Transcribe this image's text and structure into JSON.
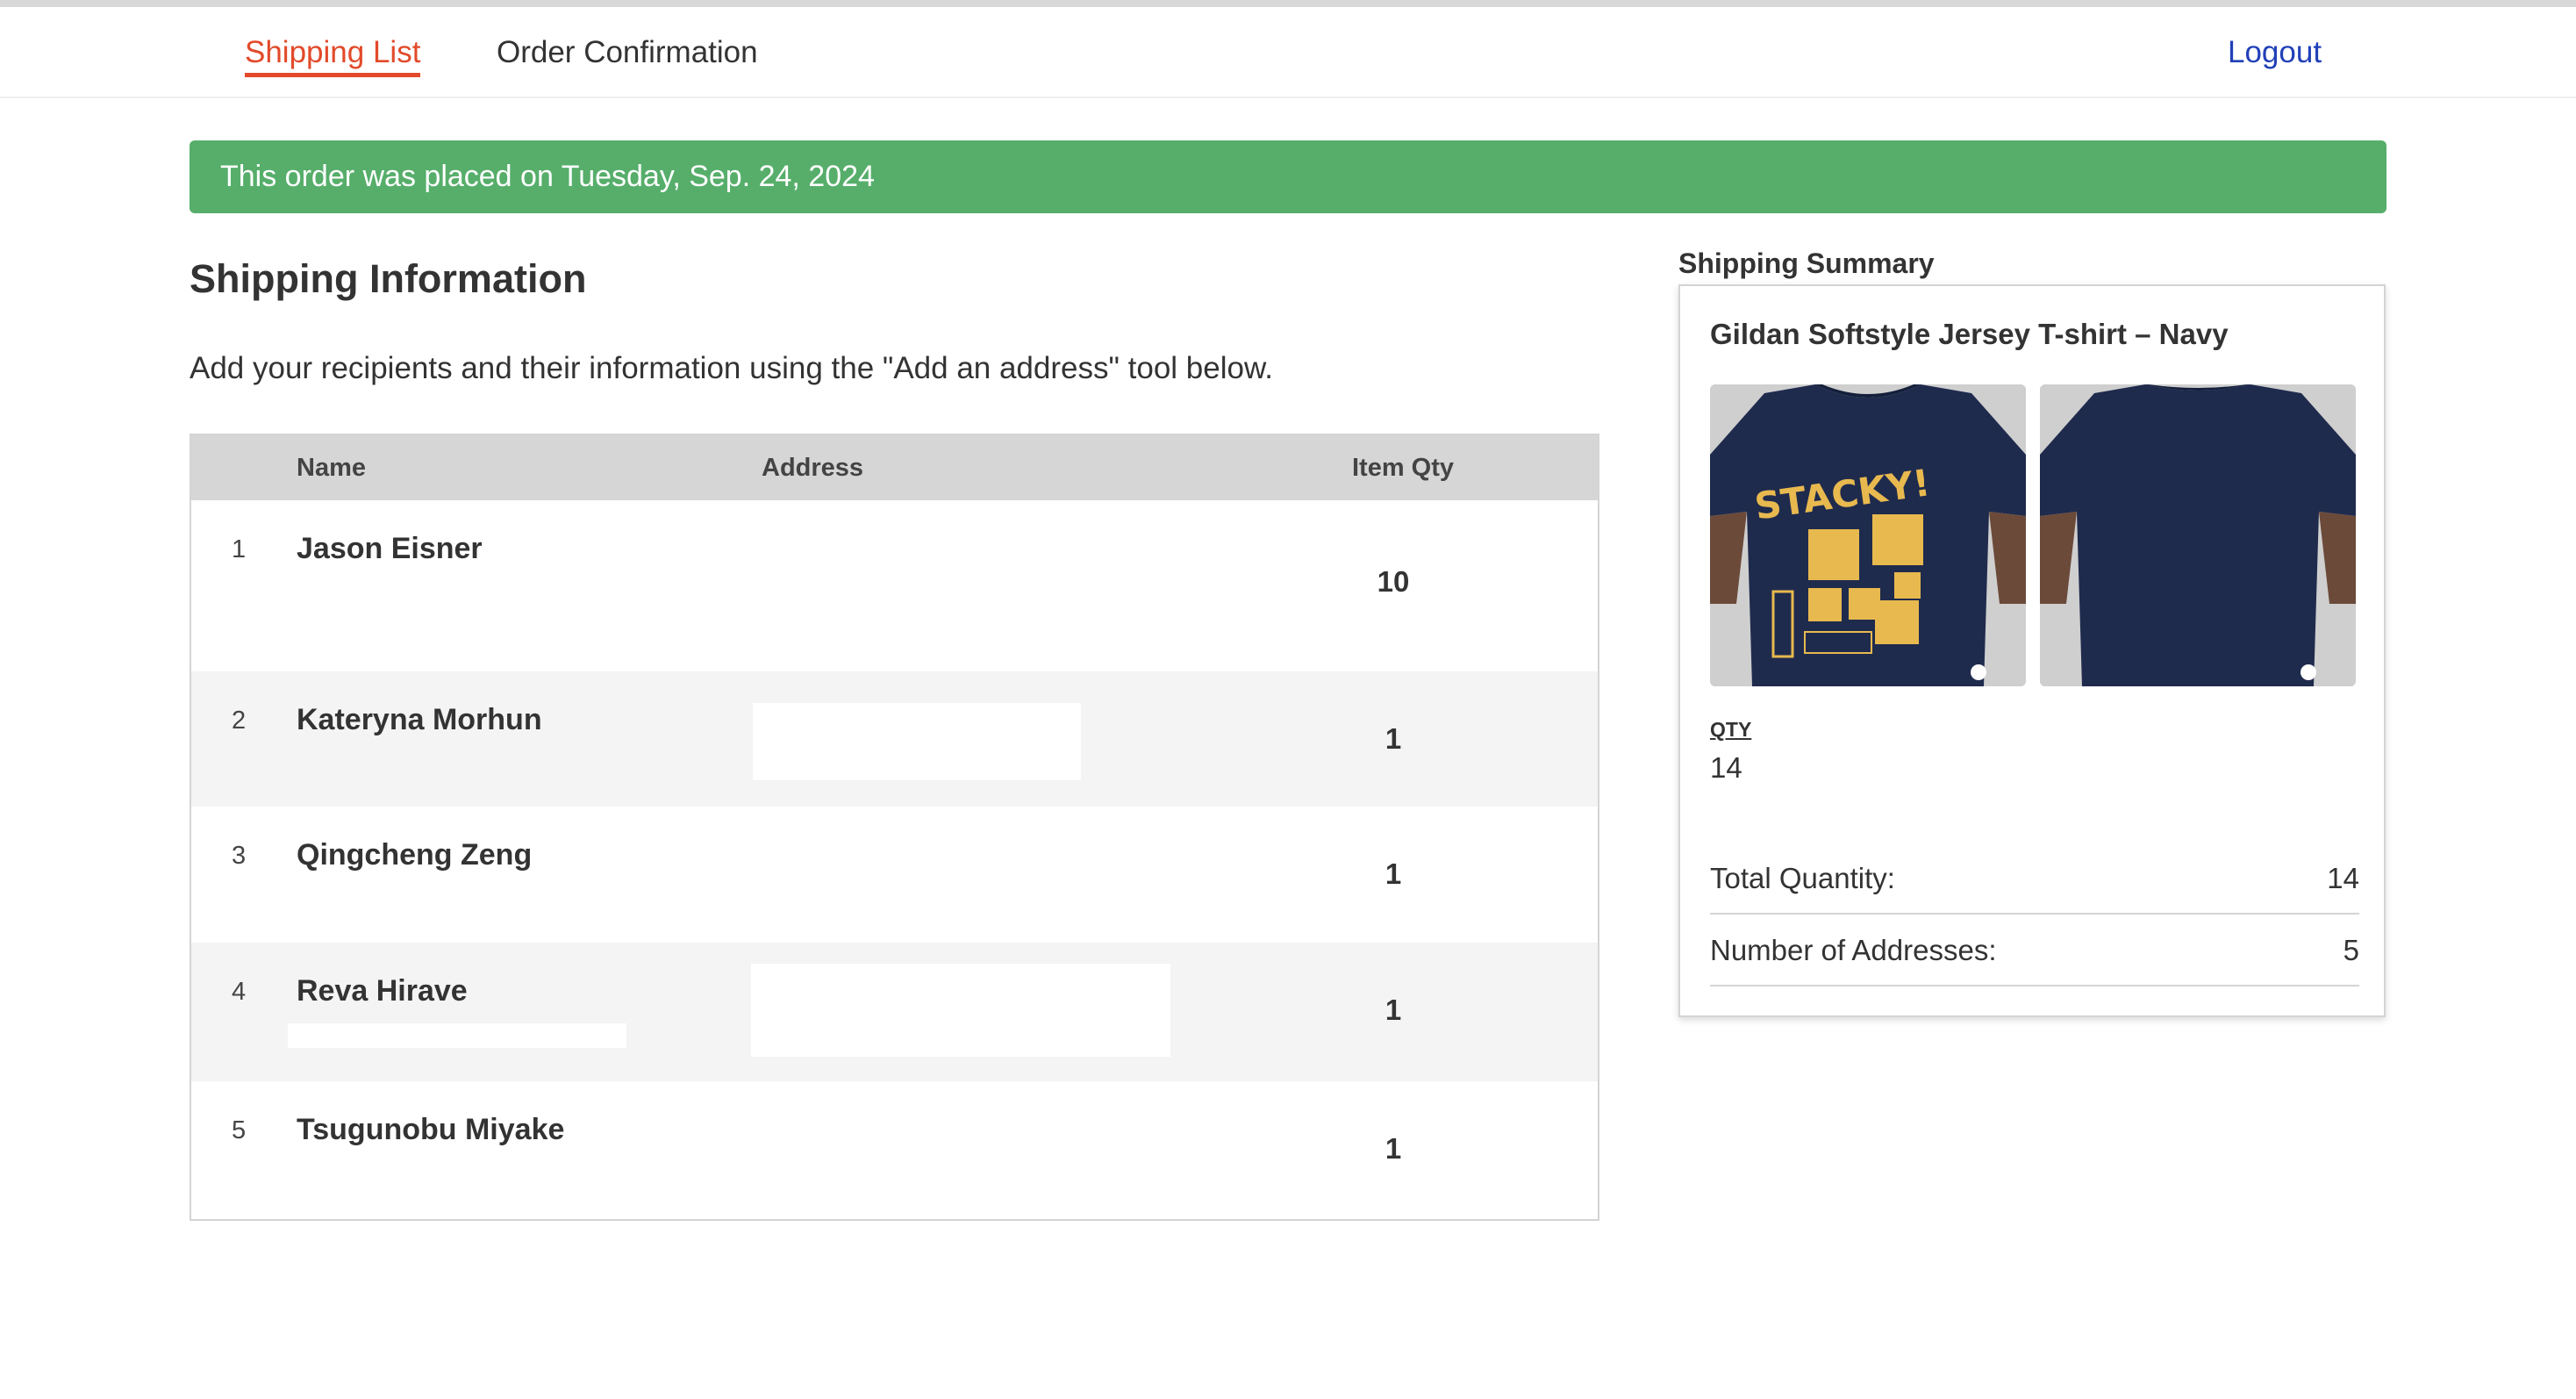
{
  "nav": {
    "shipping_list": "Shipping List",
    "order_confirmation": "Order Confirmation",
    "logout": "Logout"
  },
  "banner": {
    "text": "This order was placed on Tuesday, Sep. 24, 2024"
  },
  "shipping": {
    "title": "Shipping Information",
    "description": "Add your recipients and their information using the \"Add an address\" tool below.",
    "columns": {
      "name": "Name",
      "address": "Address",
      "qty": "Item Qty"
    },
    "rows": [
      {
        "index": "1",
        "name": "Jason Eisner",
        "qty": "10"
      },
      {
        "index": "2",
        "name": "Kateryna Morhun",
        "qty": "1"
      },
      {
        "index": "3",
        "name": "Qingcheng Zeng",
        "qty": "1"
      },
      {
        "index": "4",
        "name": "Reva Hirave",
        "qty": "1"
      },
      {
        "index": "5",
        "name": "Tsugunobu Miyake",
        "qty": "1"
      }
    ]
  },
  "summary": {
    "title": "Shipping Summary",
    "product_name": "Gildan Softstyle Jersey T-shirt – Navy",
    "shirt_print_text": "STACKY!",
    "qty_label": "QTY",
    "qty_value": "14",
    "total_quantity_label": "Total Quantity:",
    "total_quantity_value": "14",
    "addresses_label": "Number of Addresses:",
    "addresses_value": "5"
  },
  "colors": {
    "accent": "#e24a2a",
    "banner": "#56ae6a",
    "link": "#2140b8",
    "shirt_navy": "#1f2b4d",
    "print_yellow": "#e8b94f"
  }
}
